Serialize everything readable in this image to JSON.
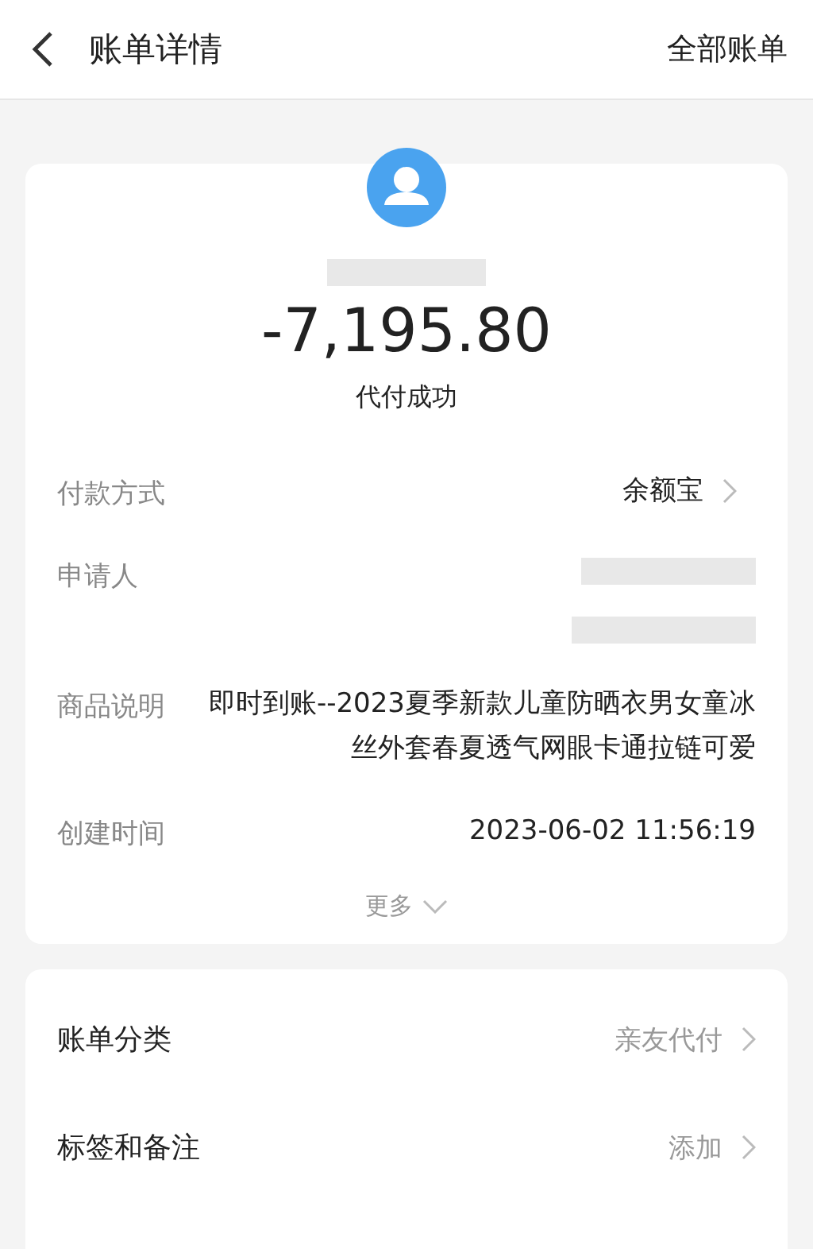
{
  "header": {
    "title": "账单详情",
    "action": "全部账单"
  },
  "summary": {
    "payee": {
      "kind": "redacted"
    },
    "amount": "-7,195.80",
    "status": "代付成功"
  },
  "details": [
    {
      "kind": "link",
      "label": "付款方式",
      "value": "余额宝"
    },
    {
      "kind": "redacted",
      "label": "申请人"
    },
    {
      "kind": "text",
      "label": "商品说明",
      "value": "即时到账--2023夏季新款儿童防晒衣男女童冰丝外套春夏透气网眼卡通拉链可爱"
    },
    {
      "kind": "text",
      "label": "创建时间",
      "value": "2023-06-02 11:56:19"
    }
  ],
  "more": "更多",
  "options": [
    {
      "label": "账单分类",
      "value": "亲友代付"
    },
    {
      "label": "标签和备注",
      "value": "添加"
    }
  ]
}
